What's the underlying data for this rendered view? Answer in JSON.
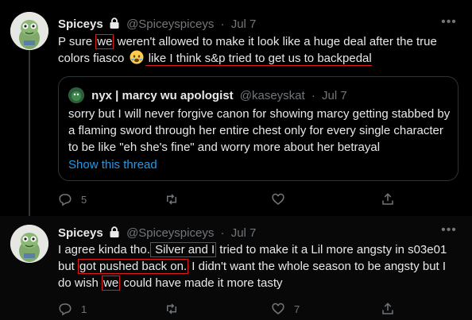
{
  "tweet1": {
    "display_name": "Spiceys",
    "handle": "@Spiceyspiceys",
    "separator": "·",
    "date": "Jul 7",
    "text_parts": {
      "a": "P sure ",
      "b": "we",
      "c": " weren't allowed to make it look like a huge deal after the true colors fiasco ",
      "d": " like I think s&p tried to get us to backpedal"
    },
    "quote": {
      "display_name": "nyx | marcy wu apologist",
      "handle": "@kaseyskat",
      "separator": "·",
      "date": "Jul 7",
      "text": "sorry but I will never forgive canon for showing marcy getting stabbed by a flaming sword through her entire chest only for every single character to be like \"eh she's fine\" and worry more about her betrayal",
      "show_thread": "Show this thread"
    },
    "actions": {
      "reply_count": "5",
      "retweet_count": "",
      "like_count": ""
    }
  },
  "tweet2": {
    "display_name": "Spiceys",
    "handle": "@Spiceyspiceys",
    "separator": "·",
    "date": "Jul 7",
    "text_parts": {
      "a": "I agree kinda tho.",
      "b": " Silver and I",
      "c": " tried to make it a Lil more angsty in s03e01 but ",
      "d": "got pushed back on.",
      "e": " I didn't want the whole season to be angsty but I do wish ",
      "f": "we",
      "g": " could have made it more tasty"
    },
    "actions": {
      "reply_count": "1",
      "retweet_count": "",
      "like_count": "7"
    }
  },
  "colors": {
    "background": "#000000",
    "text": "#e7e9ea",
    "muted": "#71767b",
    "link": "#1d9bf0",
    "annotation": "#e0191b"
  }
}
